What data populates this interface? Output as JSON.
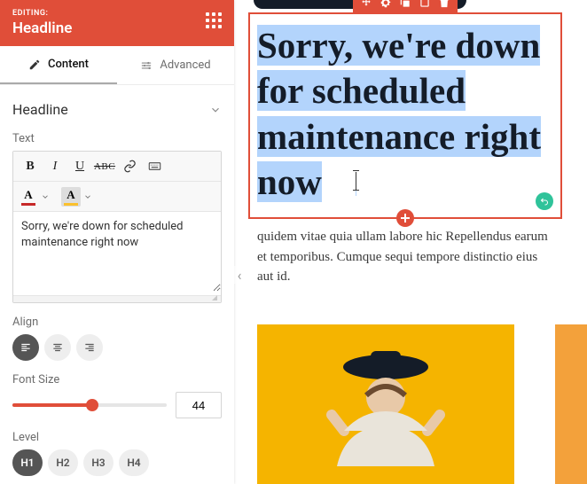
{
  "colors": {
    "accent": "#e04e39",
    "highlight": "#b3d4fc",
    "success": "#2fc39a"
  },
  "header": {
    "editing_label": "EDITING:",
    "title": "Headline"
  },
  "tabs": {
    "content": "Content",
    "advanced": "Advanced",
    "active": "content"
  },
  "section": {
    "title": "Headline"
  },
  "fields": {
    "text_label": "Text",
    "text_value": "Sorry, we're down for scheduled maintenance right now",
    "align_label": "Align",
    "align_value": "left",
    "font_size_label": "Font Size",
    "font_size_value": "44",
    "font_size_fill_pct": 52,
    "level_label": "Level",
    "level_options": [
      "H1",
      "H2",
      "H3",
      "H4"
    ],
    "level_value": "H1"
  },
  "rtf_icons": {
    "bold": "B",
    "italic": "I",
    "underline": "U",
    "strike": "ABC",
    "text_color_glyph": "A",
    "bg_color_glyph": "A"
  },
  "canvas": {
    "headline": "Sorry, we're down for scheduled maintenance right now",
    "body_text": "quidem vitae quia ullam labore hic Repellendus earum et temporibus. Cumque sequi tempore distinctio eius aut id."
  }
}
